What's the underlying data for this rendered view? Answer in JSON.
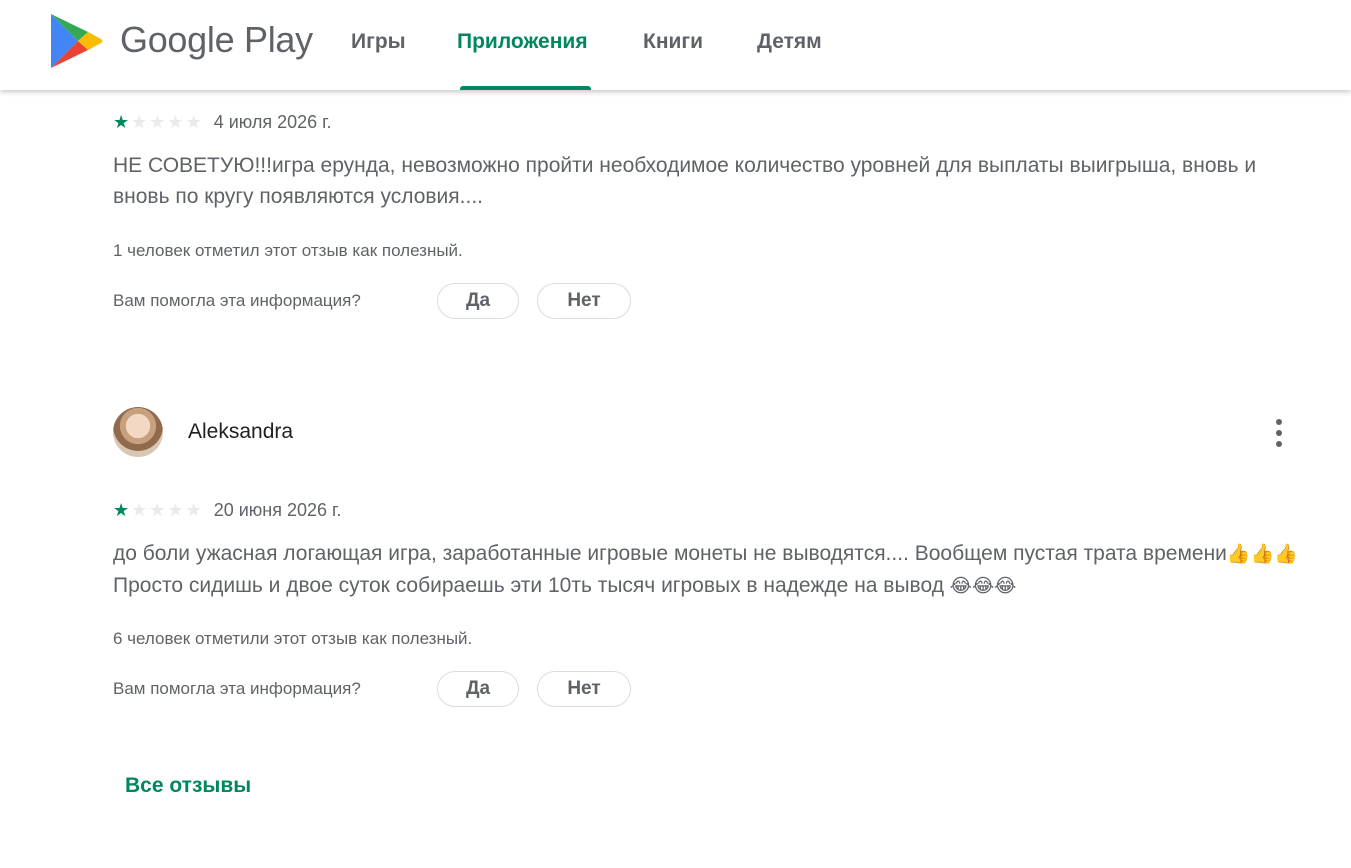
{
  "header": {
    "brand": "Google Play",
    "tabs": [
      {
        "label": "Игры"
      },
      {
        "label": "Приложения"
      },
      {
        "label": "Книги"
      },
      {
        "label": "Детям"
      }
    ],
    "active_tab": "Приложения",
    "accent_color": "#01875f"
  },
  "reviews": [
    {
      "rating": 1,
      "max_rating": 5,
      "date": "4 июля 2026 г.",
      "text": "НЕ СОВЕТУЮ!!!игра ерунда, невозможно пройти необходимое количество уровней для выплаты выигрыша, вновь и вновь по кругу появляются условия....",
      "helpful": "1 человек отметил этот отзыв как полезный.",
      "question": "Вам помогла эта информация?",
      "yes": "Да",
      "no": "Нет"
    },
    {
      "author": "Aleksandra",
      "rating": 1,
      "max_rating": 5,
      "date": "20 июня 2026 г.",
      "text_part1": "до боли ужасная логающая игра, заработанные игровые монеты не выводятся.... Вообщем пустая трата времени",
      "emoji_a": "👍👍👍",
      "text_part2": " Просто сидишь и двое суток собираешь эти 10ть тысяч игровых в надежде на вывод ",
      "emoji_b": "😂😂😂",
      "helpful": "6 человек отметили этот отзыв как полезный.",
      "question": "Вам помогла эта информация?",
      "yes": "Да",
      "no": "Нет"
    }
  ],
  "all_reviews_link": "Все отзывы",
  "icons": {
    "logo": "google-play-logo-icon",
    "star": "star-icon",
    "more": "more-vert-icon"
  }
}
